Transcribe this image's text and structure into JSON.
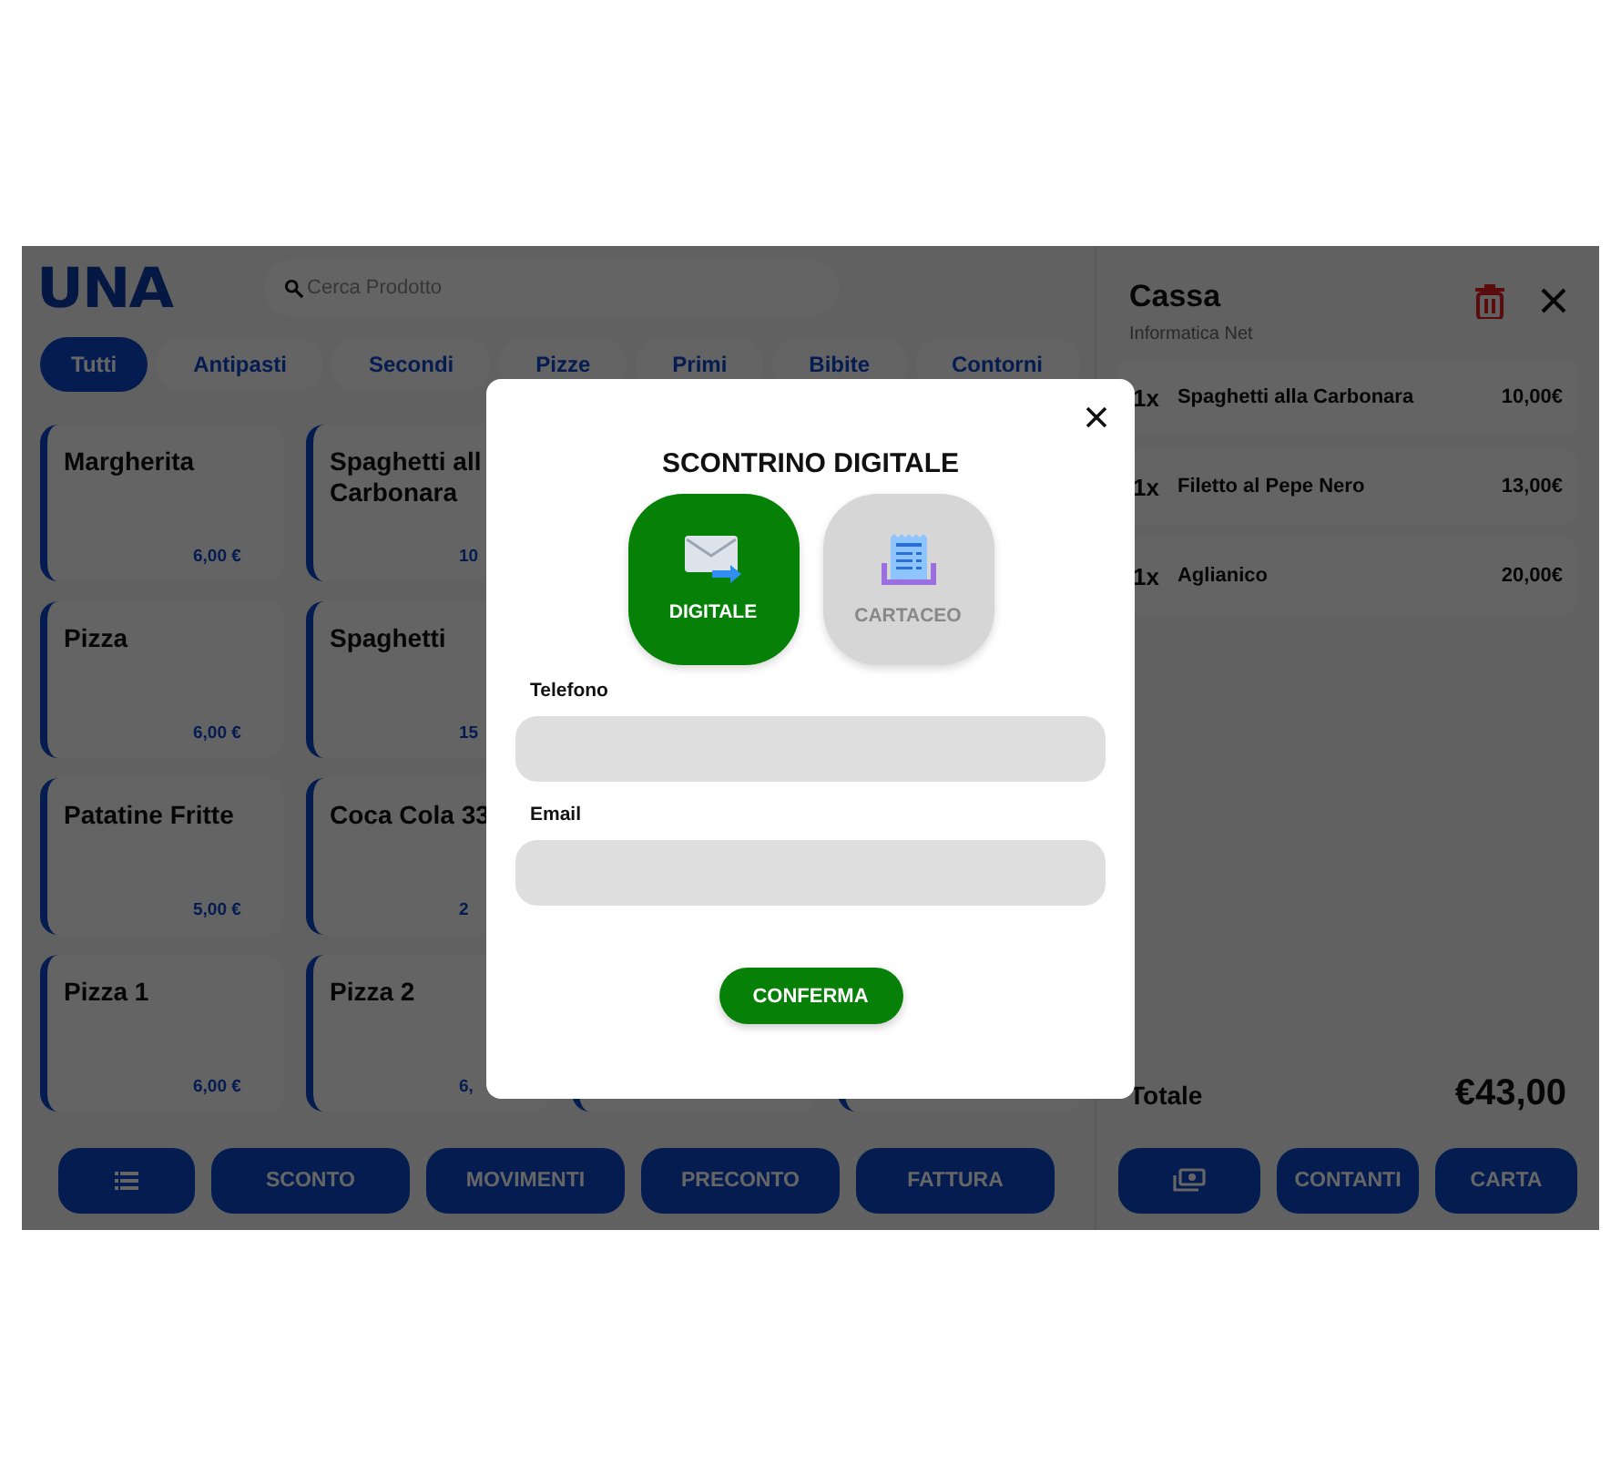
{
  "app": {
    "logo": "UNA",
    "search": {
      "placeholder": "Cerca Prodotto"
    }
  },
  "tabs": [
    {
      "label": "Tutti",
      "selected": true
    },
    {
      "label": "Antipasti",
      "selected": false
    },
    {
      "label": "Secondi",
      "selected": false
    },
    {
      "label": "Pizze",
      "selected": false
    },
    {
      "label": "Primi",
      "selected": false
    },
    {
      "label": "Bibite",
      "selected": false
    },
    {
      "label": "Contorni",
      "selected": false
    }
  ],
  "products": [
    [
      {
        "name": "Margherita",
        "price": "6,00 €"
      },
      {
        "name": "Spaghetti all\nCarbonara",
        "price": "10"
      }
    ],
    [
      {
        "name": "Pizza",
        "price": "6,00 €"
      },
      {
        "name": "Spaghetti",
        "price": "15"
      }
    ],
    [
      {
        "name": "Patatine Fritte",
        "price": "5,00 €"
      },
      {
        "name": "Coca Cola 33",
        "price": "2"
      }
    ],
    [
      {
        "name": "Pizza 1",
        "price": "6,00 €"
      },
      {
        "name": "Pizza 2",
        "price": "6,"
      }
    ]
  ],
  "actions": [
    {
      "kind": "icon"
    },
    {
      "kind": "text",
      "label": "SCONTO"
    },
    {
      "kind": "text",
      "label": "MOVIMENTI"
    },
    {
      "kind": "text",
      "label": "PRECONTO"
    },
    {
      "kind": "text",
      "label": "FATTURA"
    }
  ],
  "cart": {
    "title": "Cassa",
    "subtitle": "Informatica Net",
    "items": [
      {
        "qty": "1x",
        "name": "Spaghetti alla Carbonara",
        "price": "10,00€"
      },
      {
        "qty": "1x",
        "name": "Filetto al Pepe Nero",
        "price": "13,00€"
      },
      {
        "qty": "1x",
        "name": "Aglianico",
        "price": "20,00€"
      }
    ],
    "total_label": "Totale",
    "total": "€43,00",
    "payments": [
      {
        "kind": "icon"
      },
      {
        "kind": "text",
        "label": "CONTANTI"
      },
      {
        "kind": "text",
        "label": "CARTA"
      }
    ]
  },
  "modal": {
    "title": "SCONTRINO DIGITALE",
    "options": [
      {
        "kind": "email",
        "label": "DIGITALE",
        "selected": true
      },
      {
        "kind": "paper",
        "label": "CARTACEO",
        "selected": false
      }
    ],
    "fields": [
      {
        "label": "Telefono"
      },
      {
        "label": "Email"
      }
    ],
    "confirm": "CONFERMA"
  }
}
